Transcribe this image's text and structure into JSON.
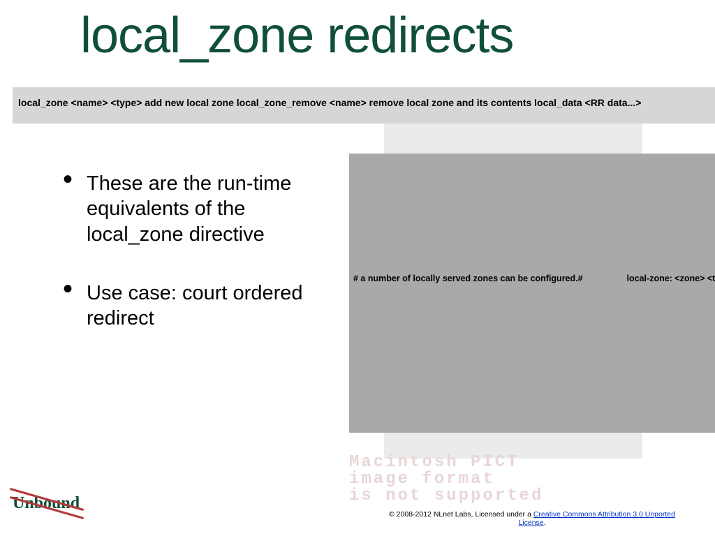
{
  "title": "local_zone redirects",
  "commandBar": "local_zone <name> <type>      add new local zone  local_zone_remove <name>       remove local zone and its contents  local_data <RR data...>",
  "bullets": [
    "These are the run-time equivalents of the local_zone directive",
    "Use case: court ordered redirect"
  ],
  "ghostRow": {
    "left": "# a number of locally served zones can be configured.#",
    "right": "local-zone: <zone> <type>#"
  },
  "macWarning": "Macintosh PICT\nimage format\nis not supported",
  "logo": "Unbound",
  "footer": {
    "prefix": "© 2008-2012 NLnet Labs, Licensed under a ",
    "link1": "Creative Commons Attribution 3.0 Unported",
    "link2": "License",
    "suffix": "."
  }
}
